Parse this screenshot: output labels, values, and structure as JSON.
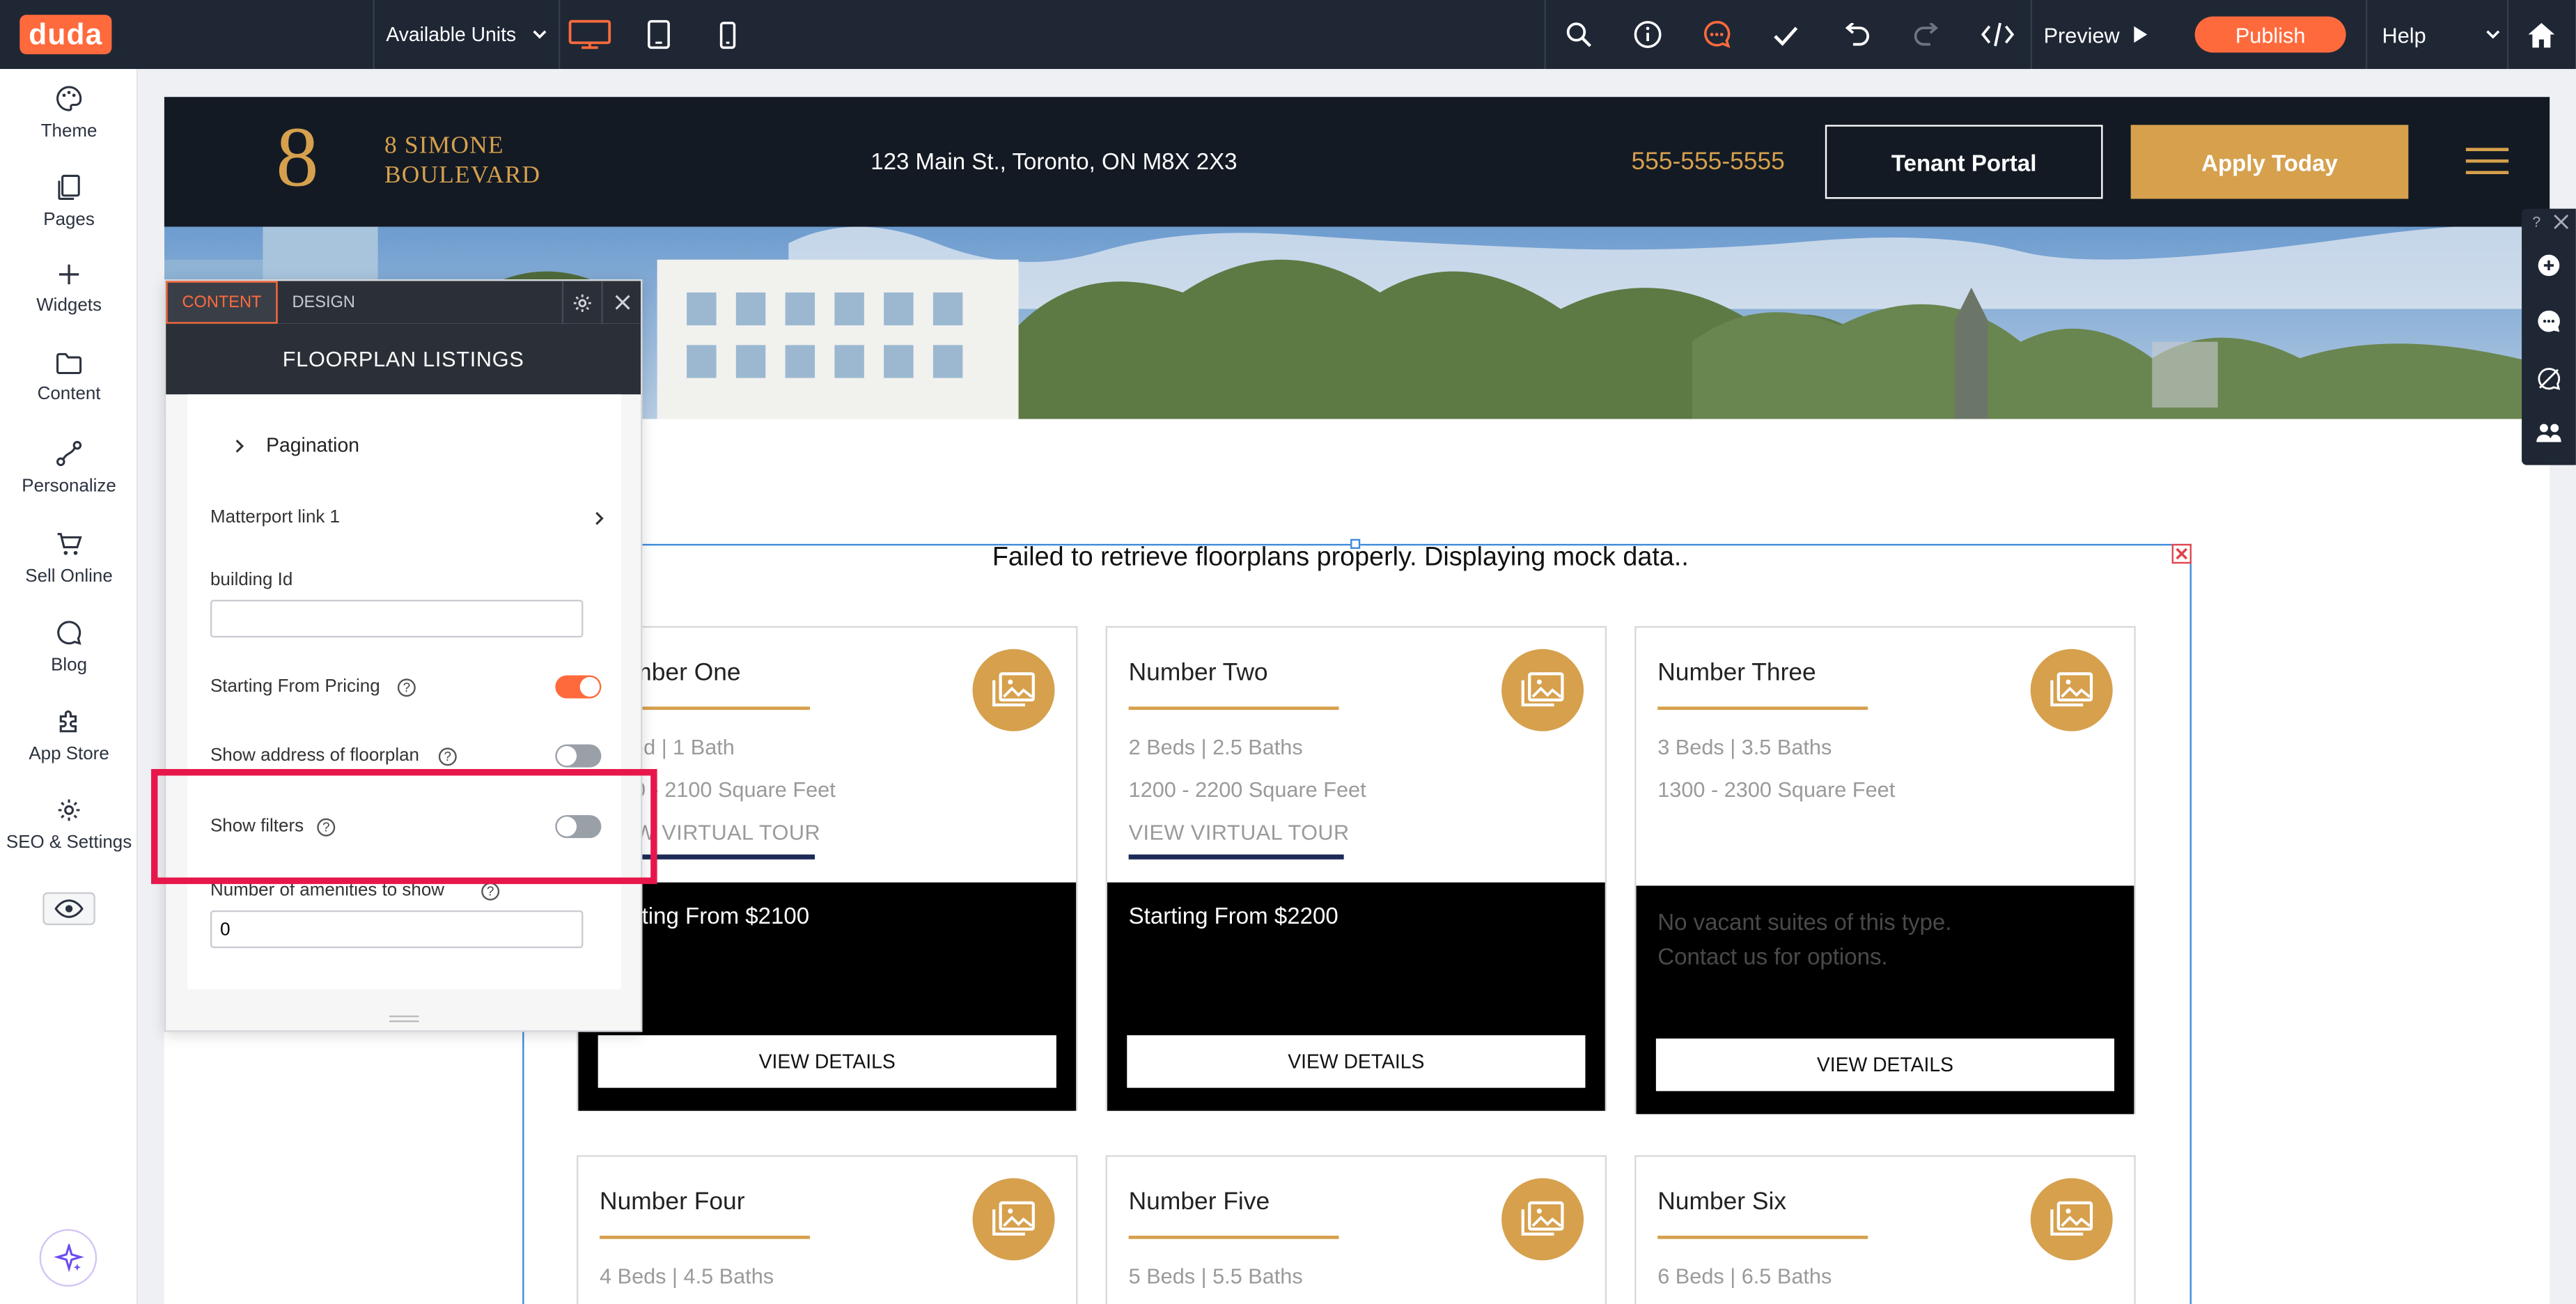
{
  "topbar": {
    "logo": "duda",
    "page_selector": "Available Units",
    "preview": "Preview",
    "publish": "Publish",
    "help": "Help"
  },
  "leftnav": {
    "items": [
      {
        "label": "Theme",
        "icon": "palette-icon"
      },
      {
        "label": "Pages",
        "icon": "pages-icon"
      },
      {
        "label": "Widgets",
        "icon": "plus-icon"
      },
      {
        "label": "Content",
        "icon": "folder-icon"
      },
      {
        "label": "Personalize",
        "icon": "personalize-icon"
      },
      {
        "label": "Sell Online",
        "icon": "cart-icon"
      },
      {
        "label": "Blog",
        "icon": "chat-bubble-icon"
      },
      {
        "label": "App Store",
        "icon": "puzzle-icon"
      },
      {
        "label": "SEO & Settings",
        "icon": "gear-icon"
      }
    ]
  },
  "site": {
    "brand_line1": "8 SIMONE",
    "brand_line2": "BOULEVARD",
    "address": "123 Main St., Toronto, ON M8X 2X3",
    "phone": "555-555-5555",
    "tenant_portal": "Tenant Portal",
    "apply_today": "Apply Today",
    "error_message": "Failed to retrieve floorplans properly. Displaying mock data..",
    "cards": [
      {
        "title": "Number One",
        "beds": "1 Bed | 1 Bath",
        "sqft": "1100 - 2100 Square Feet",
        "tour": "VIEW VIRTUAL TOUR",
        "price_line1": "Starting From $2100",
        "price_line2": "",
        "details": "VIEW DETAILS"
      },
      {
        "title": "Number Two",
        "beds": "2 Beds | 2.5 Baths",
        "sqft": "1200 - 2200 Square Feet",
        "tour": "VIEW VIRTUAL TOUR",
        "price_line1": "Starting From $2200",
        "price_line2": "",
        "details": "VIEW DETAILS"
      },
      {
        "title": "Number Three",
        "beds": "3 Beds | 3.5 Baths",
        "sqft": "1300 - 2300 Square Feet",
        "tour": "",
        "price_line1": "No vacant suites of this type.",
        "price_line2": "Contact us for options.",
        "details": "VIEW DETAILS"
      },
      {
        "title": "Number Four",
        "beds": "4 Beds | 4.5 Baths"
      },
      {
        "title": "Number Five",
        "beds": "5 Beds | 5.5 Baths"
      },
      {
        "title": "Number Six",
        "beds": "6 Beds | 6.5 Baths"
      }
    ]
  },
  "panel": {
    "tab_content": "CONTENT",
    "tab_design": "DESIGN",
    "title": "FLOORPLAN LISTINGS",
    "pagination": "Pagination",
    "matterport": "Matterport link 1",
    "building_id_label": "building Id",
    "building_id_value": "",
    "starting_from_pricing": "Starting From Pricing",
    "starting_from_pricing_on": true,
    "show_address": "Show address of floorplan",
    "show_address_on": false,
    "show_filters": "Show filters",
    "show_filters_on": false,
    "amenities_label": "Number of amenities to show",
    "amenities_value": "0"
  },
  "colors": {
    "accent": "#ff6a3d",
    "gold": "#d6a04d",
    "highlight": "#e8174b",
    "selection": "#1a73e8",
    "dark": "#1f2735"
  }
}
